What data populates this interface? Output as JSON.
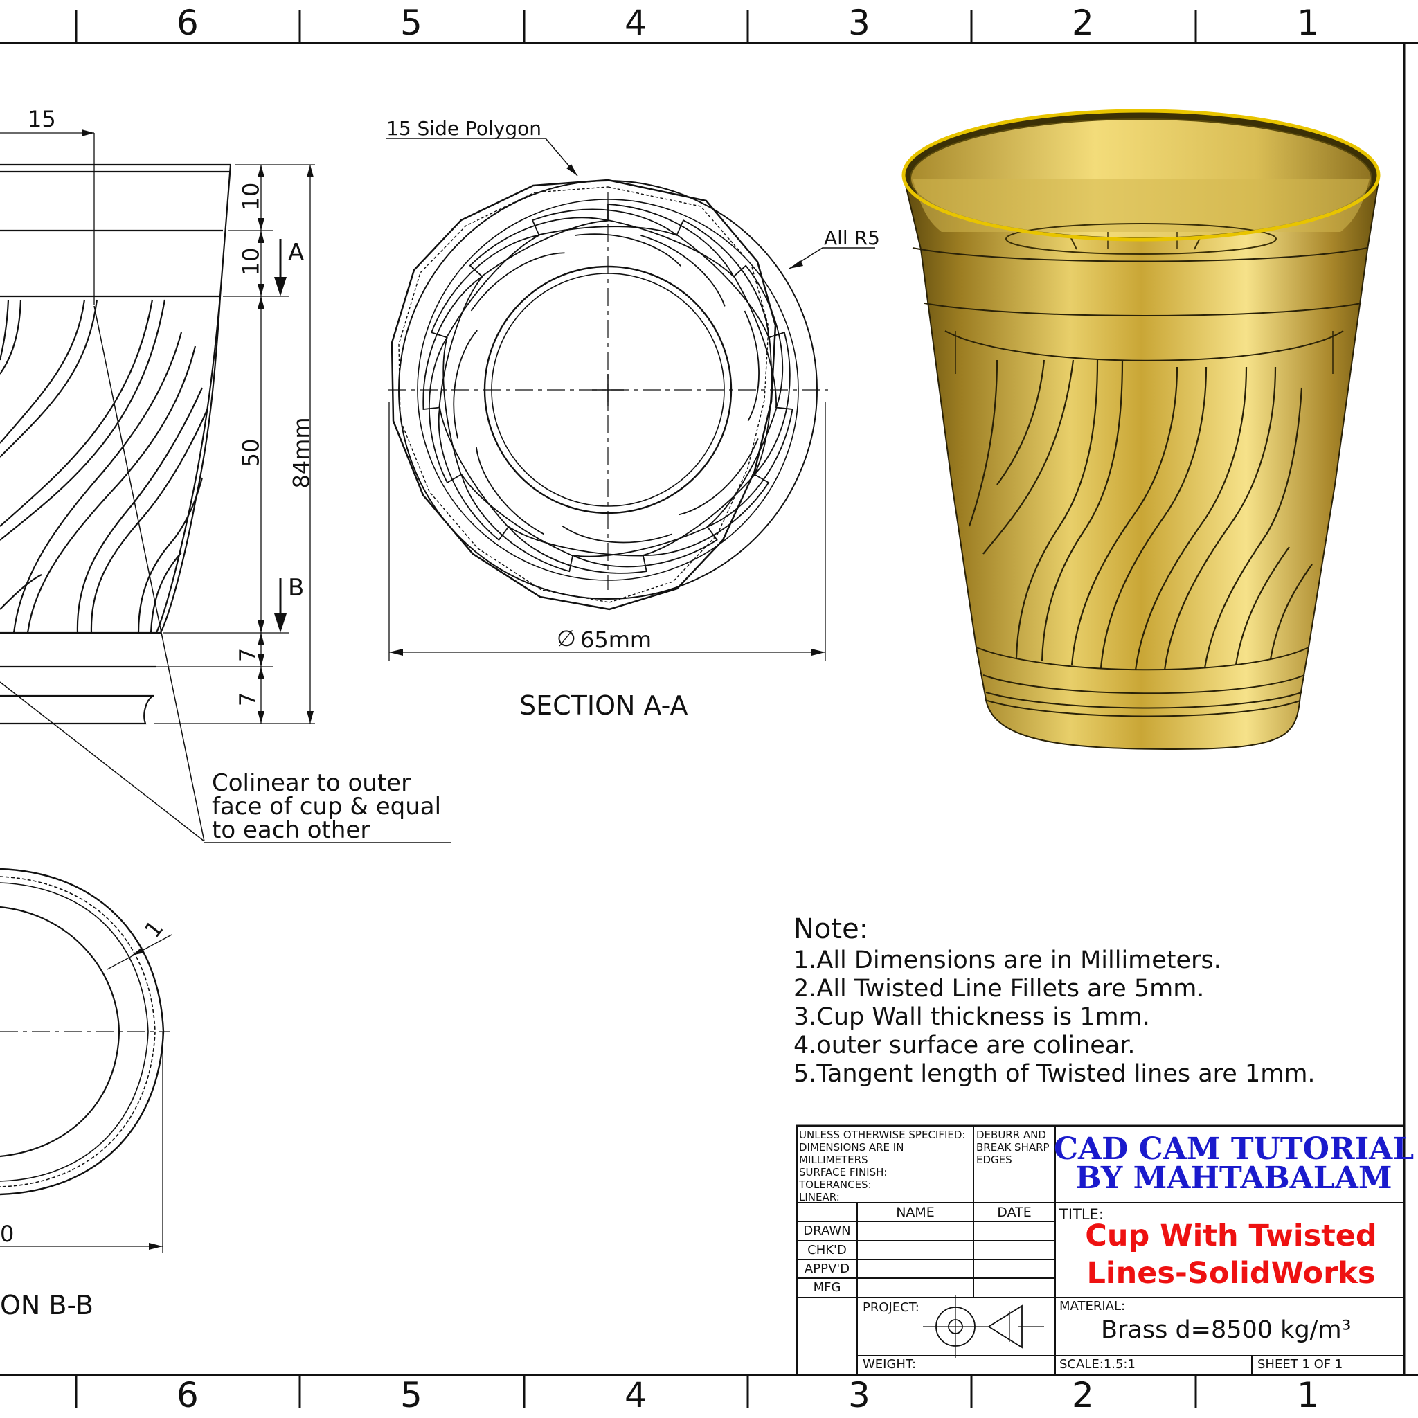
{
  "zones": {
    "top": [
      "6",
      "5",
      "4",
      "3",
      "2",
      "1"
    ],
    "bottom": [
      "6",
      "5",
      "4",
      "3",
      "2",
      "1"
    ]
  },
  "front_view": {
    "dim_top_offset": "15",
    "dim_rim_band": "10",
    "dim_upper_band": "10",
    "dim_twist_zone": "50",
    "dim_overall_height": "84mm",
    "dim_lower_band": "7",
    "dim_base": "7",
    "section_a_letter": "A",
    "section_b_letter": "B",
    "colinear_note": [
      "Colinear to outer",
      "face of cup & equal",
      "to each other"
    ]
  },
  "section_aa": {
    "polygon_note": "15 Side Polygon",
    "radius_note": "All R5",
    "diameter": "65mm",
    "diameter_symbol": "∅",
    "label": "SECTION A-A"
  },
  "section_bb": {
    "wall_dim": "1",
    "partial_dim": "0",
    "label_fragment": "ON B-B"
  },
  "notes": {
    "title": "Note:",
    "lines": [
      "1.All Dimensions are in Millimeters.",
      "2.All Twisted Line Fillets are 5mm.",
      "3.Cup Wall thickness is 1mm.",
      "4.outer surface are colinear.",
      "5.Tangent length of Twisted lines are 1mm."
    ]
  },
  "title_block": {
    "spec_lines": [
      "UNLESS OTHERWISE SPECIFIED:",
      "DIMENSIONS ARE IN MILLIMETERS",
      "SURFACE FINISH:",
      "TOLERANCES:",
      "LINEAR:"
    ],
    "deburr_lines": [
      "DEBURR AND",
      "BREAK SHARP",
      "EDGES"
    ],
    "brand_line1": "CAD CAM TUTORIAL",
    "brand_line2": "BY MAHTABALAM",
    "col_name": "NAME",
    "col_date": "DATE",
    "rows": [
      "DRAWN",
      "CHK'D",
      "APPV'D",
      "MFG"
    ],
    "title_label": "TITLE:",
    "title_line1": "Cup With Twisted",
    "title_line2": "Lines-SolidWorks",
    "project_label": "PROJECT:",
    "material_label": "MATERIAL:",
    "material_value": "Brass d=8500 kg/m³",
    "weight_label": "WEIGHT:",
    "scale": "SCALE:1.5:1",
    "sheet": "SHEET 1 OF 1"
  },
  "colors": {
    "line": "#111111",
    "brass_light": "#f3dc7a",
    "brass_mid": "#c9a636",
    "brass_dark": "#6b5410",
    "brand_blue": "#1a1acc",
    "title_red": "#ee1111"
  }
}
